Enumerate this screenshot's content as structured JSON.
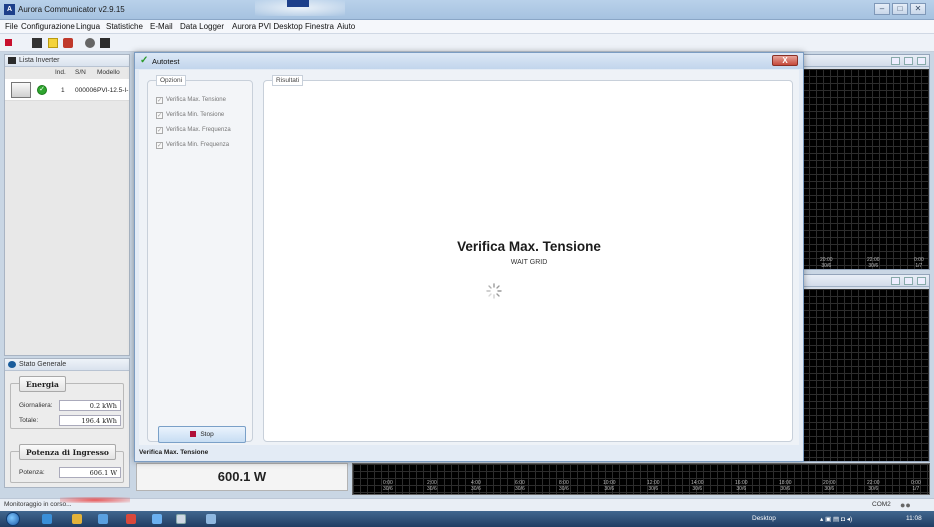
{
  "app": {
    "title": "Aurora Communicator v2.9.15",
    "icon": "app-logo-icon"
  },
  "menu": [
    "File",
    "Configurazione",
    "Lingua",
    "Statistiche",
    "E-Mail",
    "Data Logger",
    "Aurora PVI Desktop",
    "Finestra",
    "Aiuto"
  ],
  "inverter_list": {
    "title": "Lista Inverter",
    "columns": {
      "ind": "Ind.",
      "sn": "S/N",
      "model": "Modello"
    },
    "rows": [
      {
        "ind": "1",
        "sn": "000006",
        "model": "PVI-12.5-I-"
      }
    ]
  },
  "stato_generale": {
    "title": "Stato Generale",
    "energia": {
      "title": "Energia",
      "giornaliera_label": "Giornaliera:",
      "giornaliera_value": "0.2 kWh",
      "totale_label": "Totale:",
      "totale_value": "196.4 kWh"
    },
    "potenza_ingresso": {
      "title": "Potenza di Ingresso",
      "potenza_label": "Potenza:",
      "potenza_value": "606.1 W"
    }
  },
  "power_output": "600.1 W",
  "dialog": {
    "title": "Autotest",
    "close_label": "X",
    "options_title": "Opzioni",
    "options": [
      {
        "label": "Verifica Max. Tensione",
        "checked": true
      },
      {
        "label": "Verifica Min. Tensione",
        "checked": true
      },
      {
        "label": "Verifica Max. Frequenza",
        "checked": true
      },
      {
        "label": "Verifica Min. Frequenza",
        "checked": true
      }
    ],
    "stop_label": "Stop",
    "results_title": "Risultati",
    "result_heading": "Verifica Max. Tensione",
    "result_status": "WAIT GRID",
    "status_text": "Verifica Max. Tensione"
  },
  "charts": {
    "top_time_labels": [
      {
        "time": "20:00",
        "date": "30/6"
      },
      {
        "time": "22:00",
        "date": "30/6"
      },
      {
        "time": "0:00",
        "date": "1/7"
      }
    ],
    "bottom_time_labels": [
      {
        "time": "0:00",
        "date": "30/6"
      },
      {
        "time": "2:00",
        "date": "30/6"
      },
      {
        "time": "4:00",
        "date": "30/6"
      },
      {
        "time": "6:00",
        "date": "30/6"
      },
      {
        "time": "8:00",
        "date": "30/6"
      },
      {
        "time": "10:00",
        "date": "30/6"
      },
      {
        "time": "12:00",
        "date": "30/6"
      },
      {
        "time": "14:00",
        "date": "30/6"
      },
      {
        "time": "16:00",
        "date": "30/6"
      },
      {
        "time": "18:00",
        "date": "30/6"
      },
      {
        "time": "20:00",
        "date": "30/6"
      },
      {
        "time": "22:00",
        "date": "30/6"
      },
      {
        "time": "0:00",
        "date": "1/7"
      }
    ]
  },
  "statusbar": {
    "text": "Monitoraggio in corso...",
    "port": "COM2"
  },
  "taskbar": {
    "desktop_label": "Desktop",
    "clock": "11:08"
  },
  "colors": {
    "titlebar": "#b9d1ea",
    "chart_bg": "#000000",
    "ok_status": "#2ea52e",
    "stop_square": "#b0103a"
  }
}
